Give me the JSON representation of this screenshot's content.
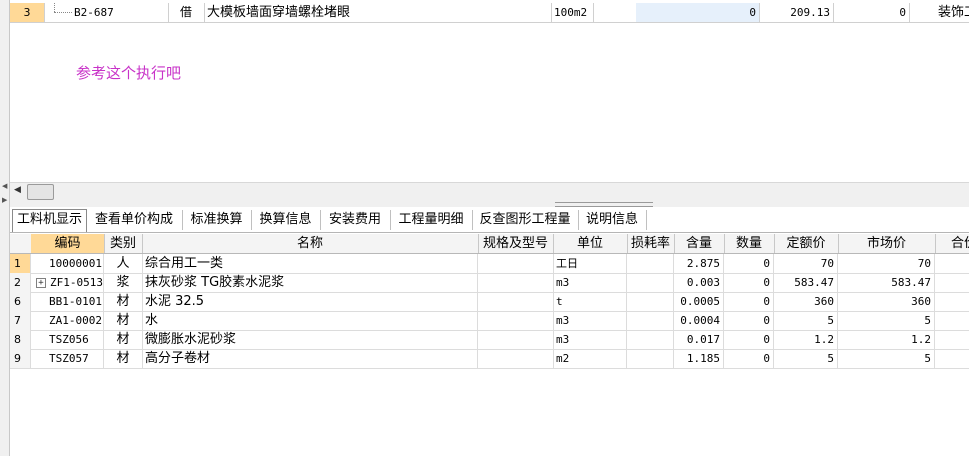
{
  "top_row": {
    "row_number": "3",
    "code": "B2-687",
    "type": "借",
    "name": "大模板墙面穿墙螺栓堵眼",
    "unit": "100m2",
    "quantity": "0",
    "unit_price": "209.13",
    "total": "0",
    "profession": "装饰工"
  },
  "note": "参考这个执行吧",
  "tabs": [
    "工料机显示",
    "查看单价构成",
    "标准换算",
    "换算信息",
    "安装费用",
    "工程量明细",
    "反查图形工程量",
    "说明信息"
  ],
  "active_tab": "工料机显示",
  "grid": {
    "headers": [
      "编码",
      "类别",
      "名称",
      "规格及型号",
      "单位",
      "损耗率",
      "含量",
      "数量",
      "定额价",
      "市场价",
      "合价"
    ],
    "rows": [
      {
        "no": "1",
        "code": "10000001",
        "cat": "人",
        "name": "综合用工一类",
        "spec": "",
        "unit": "工日",
        "loss": "",
        "content": "2.875",
        "qty": "0",
        "quota": "70",
        "market": "70"
      },
      {
        "no": "2",
        "code": "ZF1-0513",
        "cat": "浆",
        "name": "抹灰砂浆 TG胶素水泥浆",
        "spec": "",
        "unit": "m3",
        "loss": "",
        "content": "0.003",
        "qty": "0",
        "quota": "583.47",
        "market": "583.47"
      },
      {
        "no": "6",
        "code": "BB1-0101",
        "cat": "材",
        "name": "水泥 32.5",
        "spec": "",
        "unit": "t",
        "loss": "",
        "content": "0.0005",
        "qty": "0",
        "quota": "360",
        "market": "360"
      },
      {
        "no": "7",
        "code": "ZA1-0002",
        "cat": "材",
        "name": "水",
        "spec": "",
        "unit": "m3",
        "loss": "",
        "content": "0.0004",
        "qty": "0",
        "quota": "5",
        "market": "5"
      },
      {
        "no": "8",
        "code": "TSZ056",
        "cat": "材",
        "name": "微膨胀水泥砂浆",
        "spec": "",
        "unit": "m3",
        "loss": "",
        "content": "0.017",
        "qty": "0",
        "quota": "1.2",
        "market": "1.2"
      },
      {
        "no": "9",
        "code": "TSZ057",
        "cat": "材",
        "name": "高分子卷材",
        "spec": "",
        "unit": "m2",
        "loss": "",
        "content": "1.185",
        "qty": "0",
        "quota": "5",
        "market": "5"
      }
    ]
  }
}
